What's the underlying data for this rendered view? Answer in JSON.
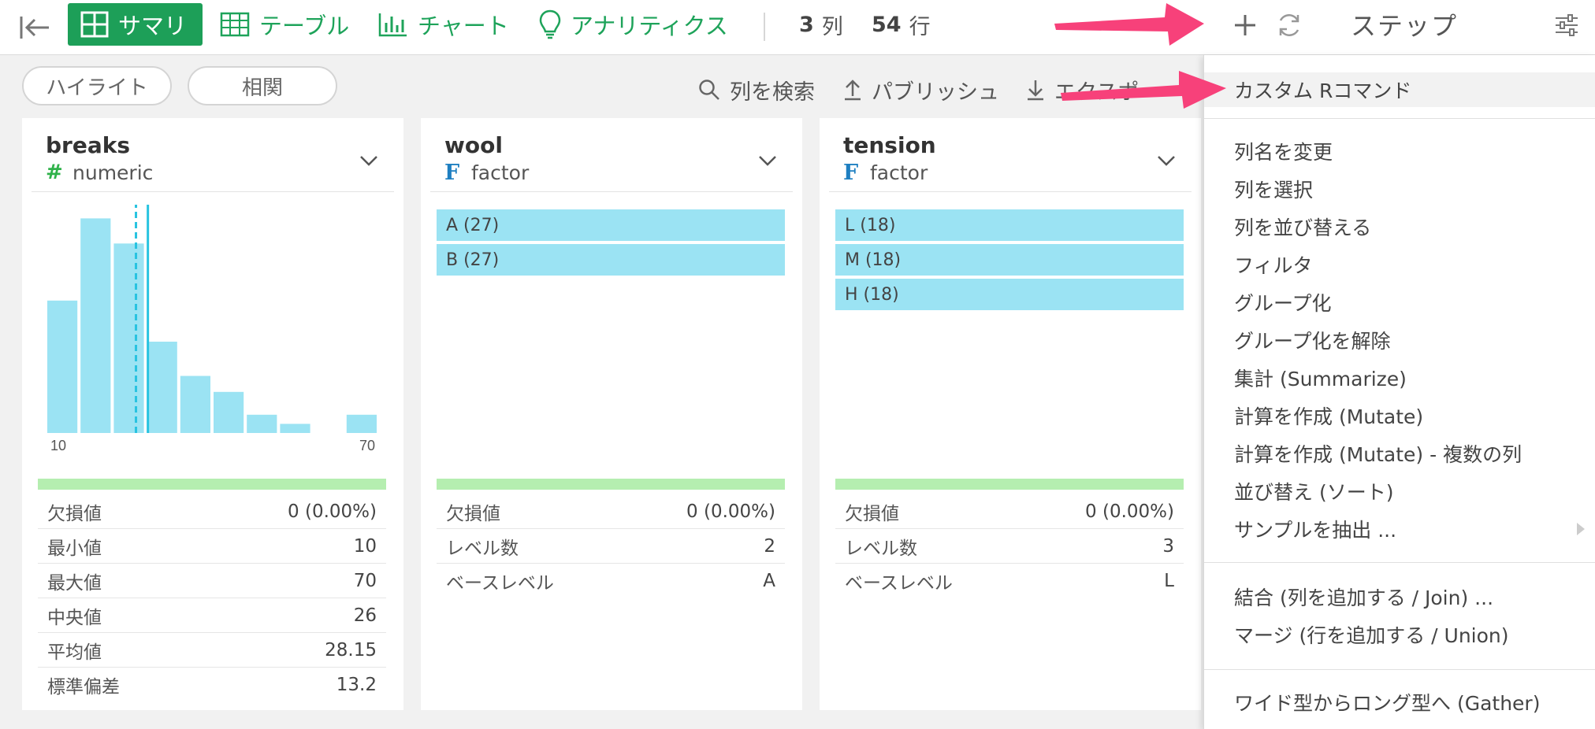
{
  "toolbar": {
    "tabs": [
      {
        "label": "サマリ",
        "active": true
      },
      {
        "label": "テーブル"
      },
      {
        "label": "チャート"
      },
      {
        "label": "アナリティクス"
      }
    ],
    "columns_count": "3",
    "columns_unit": "列",
    "rows_count": "54",
    "rows_unit": "行",
    "steps_label": "ステップ"
  },
  "subbar": {
    "highlight": "ハイライト",
    "correlation": "相関",
    "search_columns": "列を検索",
    "publish": "パブリッシュ",
    "export": "エクスポ"
  },
  "columns": [
    {
      "name": "breaks",
      "type": "numeric",
      "axis_min": "10",
      "axis_max": "70",
      "histogram": [
        0.58,
        0.94,
        0.83,
        0.4,
        0.25,
        0.18,
        0.08,
        0.04,
        0.0,
        0.08
      ],
      "median": 26,
      "mean": 28.15,
      "range": [
        10,
        70
      ],
      "stats": [
        {
          "label": "欠損値",
          "value": "0 (0.00%)"
        },
        {
          "label": "最小値",
          "value": "10"
        },
        {
          "label": "最大値",
          "value": "70"
        },
        {
          "label": "中央値",
          "value": "26"
        },
        {
          "label": "平均値",
          "value": "28.15"
        },
        {
          "label": "標準偏差",
          "value": "13.2"
        }
      ]
    },
    {
      "name": "wool",
      "type": "factor",
      "levels": [
        "A (27)",
        "B (27)"
      ],
      "stats": [
        {
          "label": "欠損値",
          "value": "0 (0.00%)"
        },
        {
          "label": "レベル数",
          "value": "2"
        },
        {
          "label": "ベースレベル",
          "value": "A"
        }
      ]
    },
    {
      "name": "tension",
      "type": "factor",
      "levels": [
        "L (18)",
        "M (18)",
        "H (18)"
      ],
      "stats": [
        {
          "label": "欠損値",
          "value": "0 (0.00%)"
        },
        {
          "label": "レベル数",
          "value": "3"
        },
        {
          "label": "ベースレベル",
          "value": "L"
        }
      ]
    }
  ],
  "menu": {
    "items": [
      "カスタム Rコマンド",
      "列名を変更",
      "列を選択",
      "列を並び替える",
      "フィルタ",
      "グループ化",
      "グループ化を解除",
      "集計 (Summarize)",
      "計算を作成 (Mutate)",
      "計算を作成 (Mutate) - 複数の列",
      "並び替え (ソート)",
      "サンプルを抽出 ...",
      "結合 (列を追加する / Join) ...",
      "マージ (行を追加する / Union)",
      "ワイド型からロング型へ (Gather)"
    ]
  },
  "colors": {
    "brand_green": "#1d9f58",
    "bar_blue": "#9be3f3",
    "arrow_pink": "#f7417a"
  }
}
